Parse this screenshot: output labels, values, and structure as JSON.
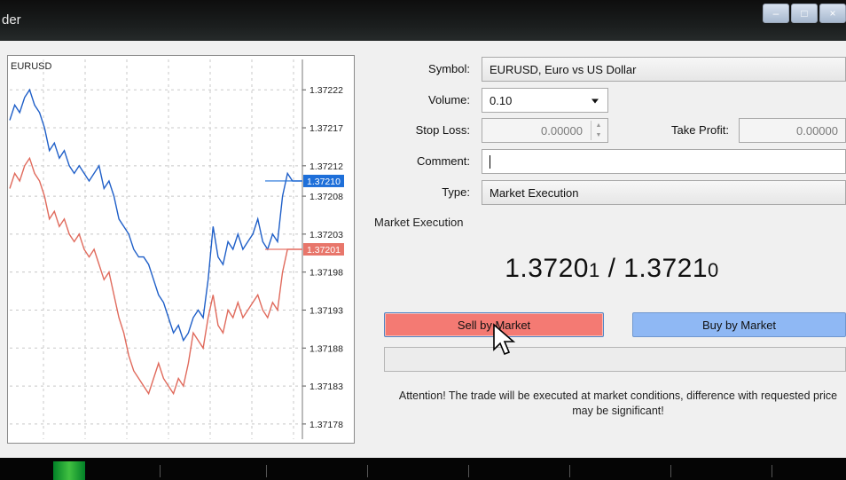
{
  "window": {
    "title": "der",
    "controls": [
      "minimize-icon",
      "maximize-icon",
      "close-icon"
    ]
  },
  "chart_data": {
    "type": "line",
    "symbol": "EURUSD",
    "y_ticks": [
      "1.37222",
      "1.37217",
      "1.37212",
      "1.37208",
      "1.37203",
      "1.37198",
      "1.37193",
      "1.37188",
      "1.37183",
      "1.37178"
    ],
    "ylim": [
      1.37176,
      1.37226
    ],
    "current_ask": {
      "label": "1.37210",
      "value": 1.3721,
      "color": "#1e6fd9"
    },
    "current_bid": {
      "label": "1.37201",
      "value": 1.37201,
      "color": "#e8766b"
    },
    "series": [
      {
        "color": "#1f5fc8",
        "values": [
          1.37218,
          1.3722,
          1.37219,
          1.37221,
          1.37222,
          1.3722,
          1.37219,
          1.37217,
          1.37214,
          1.37215,
          1.37213,
          1.37214,
          1.37212,
          1.37211,
          1.37212,
          1.37211,
          1.3721,
          1.37211,
          1.37212,
          1.37209,
          1.3721,
          1.37208,
          1.37205,
          1.37204,
          1.37203,
          1.37201,
          1.372,
          1.372,
          1.37199,
          1.37197,
          1.37195,
          1.37194,
          1.37192,
          1.3719,
          1.37191,
          1.37189,
          1.3719,
          1.37192,
          1.37193,
          1.37192,
          1.37197,
          1.37204,
          1.372,
          1.37199,
          1.37202,
          1.37201,
          1.37203,
          1.37201,
          1.37202,
          1.37203,
          1.37205,
          1.37202,
          1.37201,
          1.37203,
          1.37202,
          1.37208,
          1.37211,
          1.3721,
          1.3721,
          1.3721
        ]
      },
      {
        "color": "#e06a5c",
        "values": [
          1.37209,
          1.37211,
          1.3721,
          1.37212,
          1.37213,
          1.37211,
          1.3721,
          1.37208,
          1.37205,
          1.37206,
          1.37204,
          1.37205,
          1.37203,
          1.37202,
          1.37203,
          1.37201,
          1.372,
          1.37201,
          1.37199,
          1.37197,
          1.37198,
          1.37195,
          1.37192,
          1.3719,
          1.37187,
          1.37185,
          1.37184,
          1.37183,
          1.37182,
          1.37184,
          1.37186,
          1.37184,
          1.37183,
          1.37182,
          1.37184,
          1.37183,
          1.37186,
          1.3719,
          1.37189,
          1.37188,
          1.37192,
          1.37195,
          1.37191,
          1.3719,
          1.37193,
          1.37192,
          1.37194,
          1.37192,
          1.37193,
          1.37194,
          1.37195,
          1.37193,
          1.37192,
          1.37194,
          1.37193,
          1.37198,
          1.37201,
          1.37201,
          1.37201,
          1.37201
        ]
      }
    ]
  },
  "form": {
    "symbol_label": "Symbol:",
    "symbol_value": "EURUSD, Euro vs US Dollar",
    "volume_label": "Volume:",
    "volume_value": "0.10",
    "stop_loss_label": "Stop Loss:",
    "stop_loss_value": "0.00000",
    "take_profit_label": "Take Profit:",
    "take_profit_value": "0.00000",
    "comment_label": "Comment:",
    "comment_value": "",
    "type_label": "Type:",
    "type_value": "Market Execution"
  },
  "execution": {
    "section_title": "Market Execution",
    "quote_bid_main": "1.3720",
    "quote_bid_last": "1",
    "quote_separator": " / ",
    "quote_ask_main": "1.3721",
    "quote_ask_last": "0",
    "sell_button": "Sell by Market",
    "buy_button": "Buy by Market",
    "attention": "Attention! The trade will be executed at market conditions, difference with requested price may be significant!"
  },
  "colors": {
    "sell": "#f47a73",
    "buy": "#8fb8f4",
    "background": "#f0f0f0"
  }
}
